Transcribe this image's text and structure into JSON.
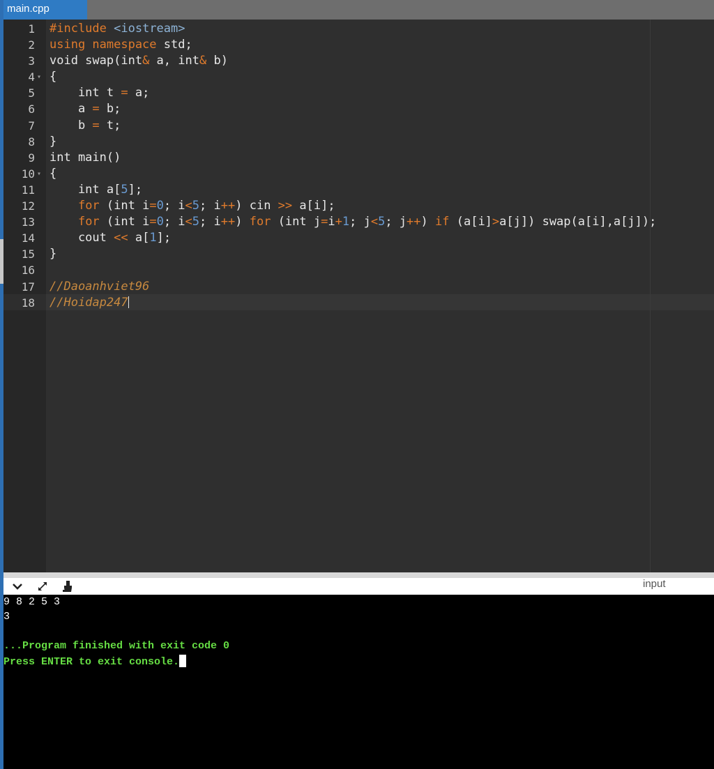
{
  "tab": {
    "label": "main.cpp"
  },
  "editor": {
    "lines": [
      {
        "n": "1",
        "fold": ""
      },
      {
        "n": "2",
        "fold": ""
      },
      {
        "n": "3",
        "fold": ""
      },
      {
        "n": "4",
        "fold": "▾"
      },
      {
        "n": "5",
        "fold": ""
      },
      {
        "n": "6",
        "fold": ""
      },
      {
        "n": "7",
        "fold": ""
      },
      {
        "n": "8",
        "fold": ""
      },
      {
        "n": "9",
        "fold": ""
      },
      {
        "n": "10",
        "fold": "▾"
      },
      {
        "n": "11",
        "fold": ""
      },
      {
        "n": "12",
        "fold": ""
      },
      {
        "n": "13",
        "fold": ""
      },
      {
        "n": "14",
        "fold": ""
      },
      {
        "n": "15",
        "fold": ""
      },
      {
        "n": "16",
        "fold": ""
      },
      {
        "n": "17",
        "fold": ""
      },
      {
        "n": "18",
        "fold": ""
      }
    ],
    "code": [
      [
        {
          "t": "#include",
          "c": "t-inc"
        },
        {
          "t": " "
        },
        {
          "t": "<iostream>",
          "c": "t-hdr"
        }
      ],
      [
        {
          "t": "using namespace",
          "c": "t-kw"
        },
        {
          "t": " std;"
        }
      ],
      [
        {
          "t": "void swap(int"
        },
        {
          "t": "&",
          "c": "t-op"
        },
        {
          "t": " a, int"
        },
        {
          "t": "&",
          "c": "t-op"
        },
        {
          "t": " b)"
        }
      ],
      [
        {
          "t": "{"
        }
      ],
      [
        {
          "t": "    int t "
        },
        {
          "t": "=",
          "c": "t-op"
        },
        {
          "t": " a;"
        }
      ],
      [
        {
          "t": "    a "
        },
        {
          "t": "=",
          "c": "t-op"
        },
        {
          "t": " b;"
        }
      ],
      [
        {
          "t": "    b "
        },
        {
          "t": "=",
          "c": "t-op"
        },
        {
          "t": " t;"
        }
      ],
      [
        {
          "t": "}"
        }
      ],
      [
        {
          "t": "int main()"
        }
      ],
      [
        {
          "t": "{"
        }
      ],
      [
        {
          "t": "    int a["
        },
        {
          "t": "5",
          "c": "t-num"
        },
        {
          "t": "];"
        }
      ],
      [
        {
          "t": "    "
        },
        {
          "t": "for",
          "c": "t-kw"
        },
        {
          "t": " (int i"
        },
        {
          "t": "=",
          "c": "t-op"
        },
        {
          "t": "0",
          "c": "t-num"
        },
        {
          "t": "; i"
        },
        {
          "t": "<",
          "c": "t-op"
        },
        {
          "t": "5",
          "c": "t-num"
        },
        {
          "t": "; i"
        },
        {
          "t": "++",
          "c": "t-op"
        },
        {
          "t": ") cin "
        },
        {
          "t": ">>",
          "c": "t-op"
        },
        {
          "t": " a[i];"
        }
      ],
      [
        {
          "t": "    "
        },
        {
          "t": "for",
          "c": "t-kw"
        },
        {
          "t": " (int i"
        },
        {
          "t": "=",
          "c": "t-op"
        },
        {
          "t": "0",
          "c": "t-num"
        },
        {
          "t": "; i"
        },
        {
          "t": "<",
          "c": "t-op"
        },
        {
          "t": "5",
          "c": "t-num"
        },
        {
          "t": "; i"
        },
        {
          "t": "++",
          "c": "t-op"
        },
        {
          "t": ") "
        },
        {
          "t": "for",
          "c": "t-kw"
        },
        {
          "t": " (int j"
        },
        {
          "t": "=",
          "c": "t-op"
        },
        {
          "t": "i"
        },
        {
          "t": "+",
          "c": "t-op"
        },
        {
          "t": "1",
          "c": "t-num"
        },
        {
          "t": "; j"
        },
        {
          "t": "<",
          "c": "t-op"
        },
        {
          "t": "5",
          "c": "t-num"
        },
        {
          "t": "; j"
        },
        {
          "t": "++",
          "c": "t-op"
        },
        {
          "t": ") "
        },
        {
          "t": "if",
          "c": "t-kw"
        },
        {
          "t": " (a[i]"
        },
        {
          "t": ">",
          "c": "t-op"
        },
        {
          "t": "a[j]) swap(a[i],a[j]);"
        }
      ],
      [
        {
          "t": "    cout "
        },
        {
          "t": "<<",
          "c": "t-op"
        },
        {
          "t": " a["
        },
        {
          "t": "1",
          "c": "t-num"
        },
        {
          "t": "];"
        }
      ],
      [
        {
          "t": "}"
        }
      ],
      [],
      [
        {
          "t": "//Daoanhviet96",
          "c": "t-cm"
        }
      ],
      [
        {
          "t": "//Hoidap247",
          "c": "t-cm"
        }
      ]
    ]
  },
  "console_bar": {
    "icons": [
      "chevron-down-icon",
      "expand-icon",
      "clear-console-icon"
    ],
    "input_label": "input"
  },
  "console": {
    "lines": [
      {
        "text": "9 8 2 5 3",
        "style": "c-white"
      },
      {
        "text": "3",
        "style": "c-white"
      },
      {
        "text": "",
        "style": "c-white"
      },
      {
        "text": "...Program finished with exit code 0",
        "style": "c-green"
      },
      {
        "text": "Press ENTER to exit console.",
        "style": "c-green"
      }
    ]
  }
}
